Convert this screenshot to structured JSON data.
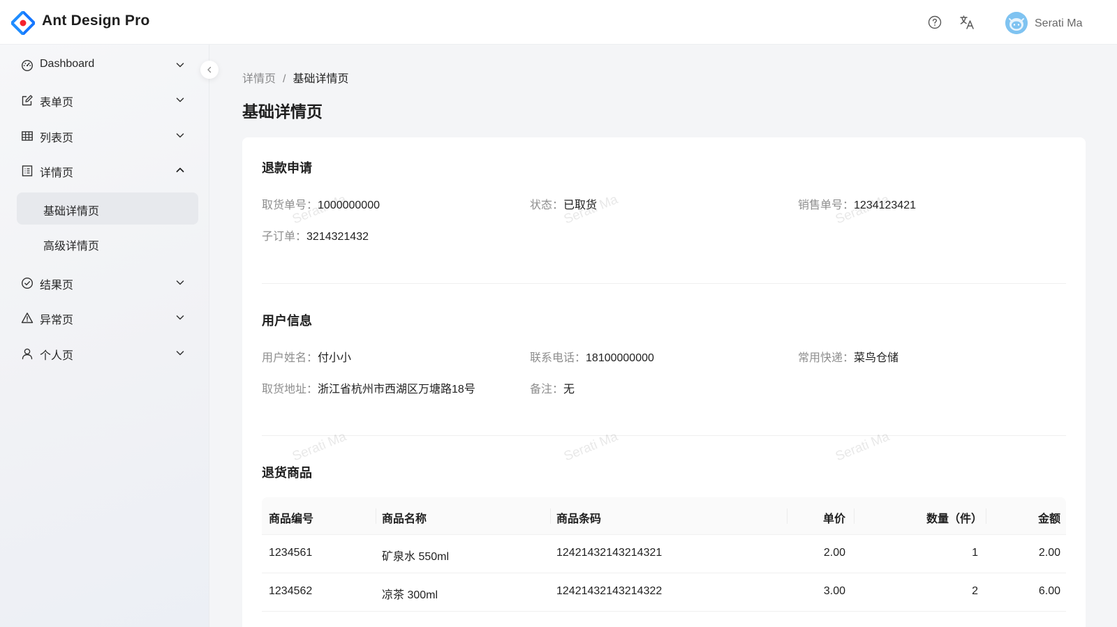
{
  "header": {
    "app_title": "Ant Design Pro",
    "user_name": "Serati Ma"
  },
  "sidebar": {
    "items": [
      {
        "label": "Dashboard",
        "icon": "dashboard-icon",
        "expanded": false
      },
      {
        "label": "表单页",
        "icon": "form-icon",
        "expanded": false
      },
      {
        "label": "列表页",
        "icon": "table-icon",
        "expanded": false
      },
      {
        "label": "详情页",
        "icon": "profile-icon",
        "expanded": true,
        "children": [
          {
            "label": "基础详情页",
            "active": true
          },
          {
            "label": "高级详情页",
            "active": false
          }
        ]
      },
      {
        "label": "结果页",
        "icon": "check-circle-icon",
        "expanded": false
      },
      {
        "label": "异常页",
        "icon": "warning-icon",
        "expanded": false
      },
      {
        "label": "个人页",
        "icon": "user-icon",
        "expanded": false
      }
    ]
  },
  "breadcrumb": {
    "parent": "详情页",
    "separator": "/",
    "current": "基础详情页"
  },
  "page_title": "基础详情页",
  "refund": {
    "title": "退款申请",
    "fields": [
      {
        "label": "取货单号：",
        "value": "1000000000"
      },
      {
        "label": "状态：",
        "value": "已取货"
      },
      {
        "label": "销售单号：",
        "value": "1234123421"
      },
      {
        "label": "子订单：",
        "value": "3214321432"
      }
    ]
  },
  "user_info": {
    "title": "用户信息",
    "fields": [
      {
        "label": "用户姓名：",
        "value": "付小小"
      },
      {
        "label": "联系电话：",
        "value": "18100000000"
      },
      {
        "label": "常用快递：",
        "value": "菜鸟仓储"
      },
      {
        "label": "取货地址：",
        "value": "浙江省杭州市西湖区万塘路18号"
      },
      {
        "label": "备注：",
        "value": "无"
      }
    ]
  },
  "goods": {
    "title": "退货商品",
    "columns": [
      "商品编号",
      "商品名称",
      "商品条码",
      "单价",
      "数量（件）",
      "金额"
    ],
    "rows": [
      [
        "1234561",
        "矿泉水 550ml",
        "12421432143214321",
        "2.00",
        "1",
        "2.00"
      ],
      [
        "1234562",
        "凉茶 300ml",
        "12421432143214322",
        "3.00",
        "2",
        "6.00"
      ]
    ]
  },
  "watermark": {
    "text": "Serati Ma"
  },
  "colors": {
    "accent": "#1677ff",
    "logo_red": "#f5222d",
    "avatar_bg": "#7fc3f1"
  }
}
